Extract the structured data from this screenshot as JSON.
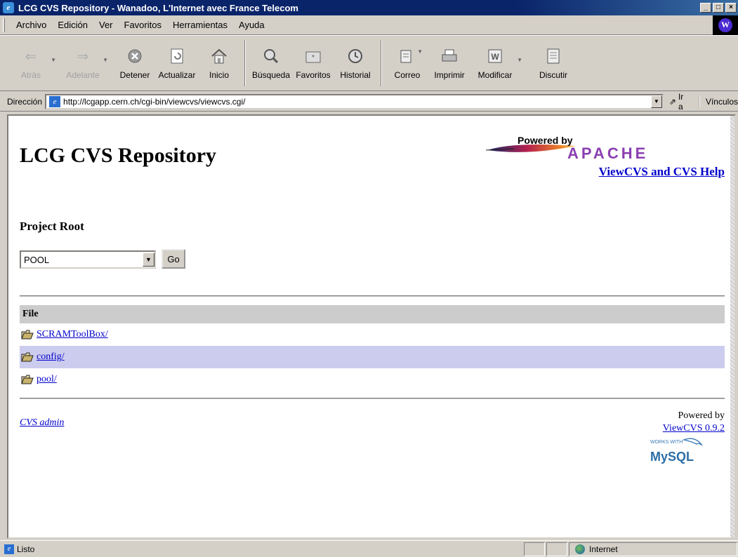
{
  "window": {
    "title": "LCG CVS Repository - Wanadoo, L'Internet avec France Telecom",
    "controls": [
      "_",
      "□",
      "×"
    ]
  },
  "menu": {
    "items": [
      "Archivo",
      "Edición",
      "Ver",
      "Favoritos",
      "Herramientas",
      "Ayuda"
    ]
  },
  "toolbar": {
    "buttons": [
      {
        "label": "Atrás",
        "icon": "back-arrow-icon",
        "enabled": false
      },
      {
        "label": "Adelante",
        "icon": "forward-arrow-icon",
        "enabled": false
      },
      {
        "label": "Detener",
        "icon": "stop-icon",
        "enabled": true
      },
      {
        "label": "Actualizar",
        "icon": "refresh-icon",
        "enabled": true
      },
      {
        "label": "Inicio",
        "icon": "home-icon",
        "enabled": true
      },
      {
        "label": "Búsqueda",
        "icon": "search-icon",
        "enabled": true
      },
      {
        "label": "Favoritos",
        "icon": "favorites-icon",
        "enabled": true
      },
      {
        "label": "Historial",
        "icon": "history-icon",
        "enabled": true
      },
      {
        "label": "Correo",
        "icon": "mail-icon",
        "enabled": true
      },
      {
        "label": "Imprimir",
        "icon": "print-icon",
        "enabled": true
      },
      {
        "label": "Modificar",
        "icon": "edit-icon",
        "enabled": true
      },
      {
        "label": "Discutir",
        "icon": "discuss-icon",
        "enabled": true
      }
    ]
  },
  "address": {
    "label": "Dirección",
    "url": "http://lcgapp.cern.ch/cgi-bin/viewcvs/viewcvs.cgi/",
    "go_label": "Ir a",
    "links_label": "Vínculos"
  },
  "page": {
    "title": "LCG CVS Repository",
    "logo_powered": "Powered by",
    "logo_apache": "APACHE",
    "help_link": "ViewCVS and CVS Help",
    "project_root_label": "Project Root",
    "root_selected": "POOL",
    "go_button": "Go",
    "table_header": "File",
    "files": [
      {
        "name": "SCRAMToolBox/"
      },
      {
        "name": "config/"
      },
      {
        "name": "pool/"
      }
    ],
    "cvs_admin": "CVS admin",
    "powered_by": "Powered by",
    "viewcvs_version": "ViewCVS 0.9.2",
    "mysql_works": "WORKS WITH",
    "mysql_brand": "MySQL"
  },
  "status": {
    "text": "Listo",
    "zone": "Internet"
  },
  "colors": {
    "titlebar": "#0a246a",
    "link": "#0000cc",
    "row_alt": "#ccccee",
    "table_header": "#cccccc"
  }
}
